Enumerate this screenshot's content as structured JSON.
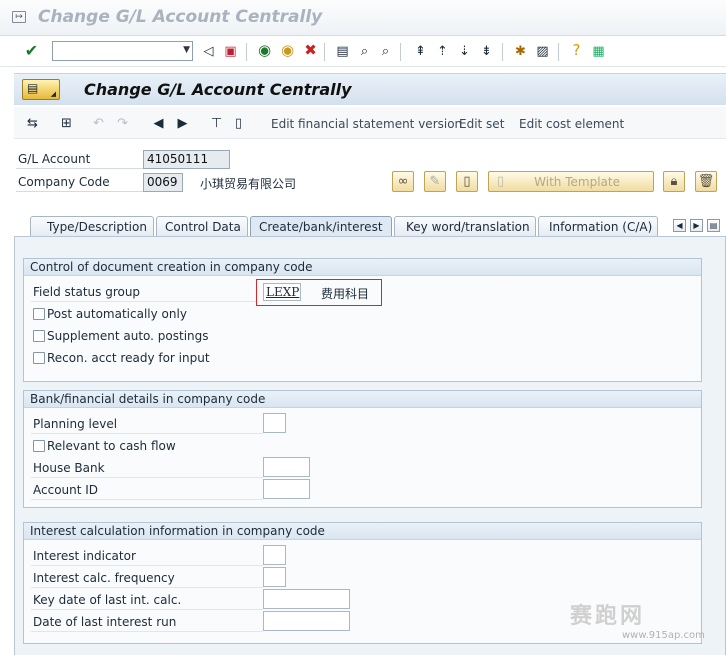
{
  "window": {
    "title": "Change G/L Account Centrally"
  },
  "page": {
    "title": "Change G/L Account Centrally"
  },
  "app_toolbar": {
    "edit_fs_version": "Edit financial statement version",
    "edit_set": "Edit set",
    "edit_cost_element": "Edit cost element"
  },
  "header": {
    "gl_account_label": "G/L Account",
    "gl_account_value": "41050111",
    "company_code_label": "Company Code",
    "company_code_value": "0069",
    "company_name": "小琪贸易有限公司",
    "with_template_label": "With Template"
  },
  "tabs": [
    {
      "label": "Type/Description"
    },
    {
      "label": "Control Data"
    },
    {
      "label": "Create/bank/interest"
    },
    {
      "label": "Key word/translation"
    },
    {
      "label": "Information (C/A)"
    }
  ],
  "group1": {
    "title": "Control of document creation in company code",
    "field_status_group_label": "Field status group",
    "field_status_group_value": "LEXP",
    "field_status_group_desc": "费用科目",
    "post_auto_label": "Post automatically only",
    "supplement_label": "Supplement auto. postings",
    "recon_label": "Recon. acct ready for input"
  },
  "group2": {
    "title": "Bank/financial details in company code",
    "planning_level_label": "Planning level",
    "relevant_cash_label": "Relevant to cash flow",
    "house_bank_label": "House Bank",
    "account_id_label": "Account ID"
  },
  "group3": {
    "title": "Interest calculation information in company code",
    "interest_indicator_label": "Interest indicator",
    "interest_freq_label": "Interest calc. frequency",
    "key_date_label": "Key date of last int. calc.",
    "last_run_label": "Date of last interest run"
  },
  "watermark": {
    "text": "赛跑网",
    "url": "www.915ap.com"
  },
  "colors": {
    "highlight_box": "#d9262a",
    "accent": "#dfe9f4"
  }
}
